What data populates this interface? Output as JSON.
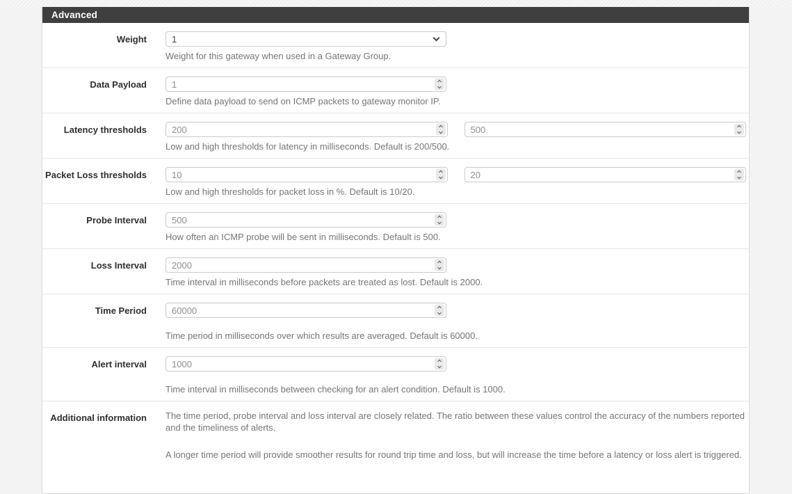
{
  "panel": {
    "title": "Advanced"
  },
  "colors": {
    "heading_bg": "#3f3f3f",
    "heading_text": "#ffffff",
    "label_text": "#2f2f2f",
    "help_text": "#757575",
    "input_text": "#8e8e8e",
    "input_border": "#cbcbcb"
  },
  "rows": [
    {
      "id": "weight",
      "label": "Weight",
      "control": "select",
      "value": "1",
      "help": "Weight for this gateway when used in a Gateway Group."
    },
    {
      "id": "data-payload",
      "label": "Data Payload",
      "control": "number",
      "value": "1",
      "help": "Define data payload to send on ICMP packets to gateway monitor IP."
    },
    {
      "id": "latency-thresholds",
      "label": "Latency thresholds",
      "control": "number-pair",
      "values": [
        "200",
        "500"
      ],
      "help": "Low and high thresholds for latency in milliseconds. Default is 200/500."
    },
    {
      "id": "packet-loss-thresholds",
      "label": "Packet Loss thresholds",
      "control": "number-pair",
      "values": [
        "10",
        "20"
      ],
      "help": "Low and high thresholds for packet loss in %. Default is 10/20."
    },
    {
      "id": "probe-interval",
      "label": "Probe Interval",
      "control": "number",
      "value": "500",
      "help": "How often an ICMP probe will be sent in milliseconds. Default is 500."
    },
    {
      "id": "loss-interval",
      "label": "Loss Interval",
      "control": "number",
      "value": "2000",
      "help": "Time interval in milliseconds before packets are treated as lost. Default is 2000."
    },
    {
      "id": "time-period",
      "label": "Time Period",
      "control": "number",
      "value": "60000",
      "help": "Time period in milliseconds over which results are averaged. Default is 60000."
    },
    {
      "id": "alert-interval",
      "label": "Alert interval",
      "control": "number",
      "value": "1000",
      "help": "Time interval in milliseconds between checking for an alert condition. Default is 1000."
    },
    {
      "id": "additional-information",
      "label": "Additional information",
      "control": "static-text",
      "paragraphs": [
        "The time period, probe interval and loss interval are closely related. The ratio between these values control the accuracy of the numbers reported and the timeliness of alerts.",
        "A longer time period will provide smoother results for round trip time and loss, but will increase the time before a latency or loss alert is triggered."
      ]
    }
  ]
}
